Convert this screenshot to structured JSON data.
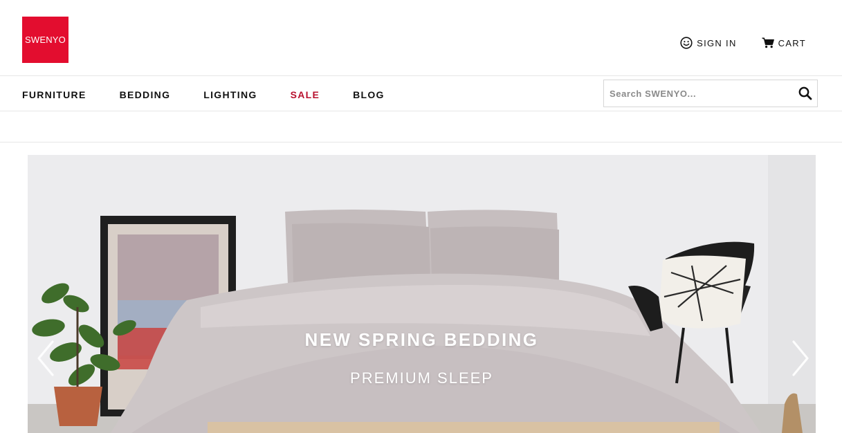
{
  "brand": {
    "logo_text": "SWENYO",
    "color": "#e30d2f"
  },
  "account": {
    "sign_in_label": "SIGN IN",
    "sign_in_icon": "smiley-icon",
    "cart_label": "CART",
    "cart_icon": "cart-icon"
  },
  "nav": {
    "items": [
      {
        "label": "FURNITURE"
      },
      {
        "label": "BEDDING"
      },
      {
        "label": "LIGHTING"
      },
      {
        "label": "SALE",
        "color": "#b8102e"
      },
      {
        "label": "BLOG"
      }
    ]
  },
  "search": {
    "placeholder": "Search SWENYO...",
    "value": "",
    "icon": "search-icon"
  },
  "hero": {
    "title": "NEW SPRING BEDDING",
    "subtitle": "PREMIUM SLEEP",
    "prev_icon": "chevron-left-icon",
    "next_icon": "chevron-right-icon"
  }
}
